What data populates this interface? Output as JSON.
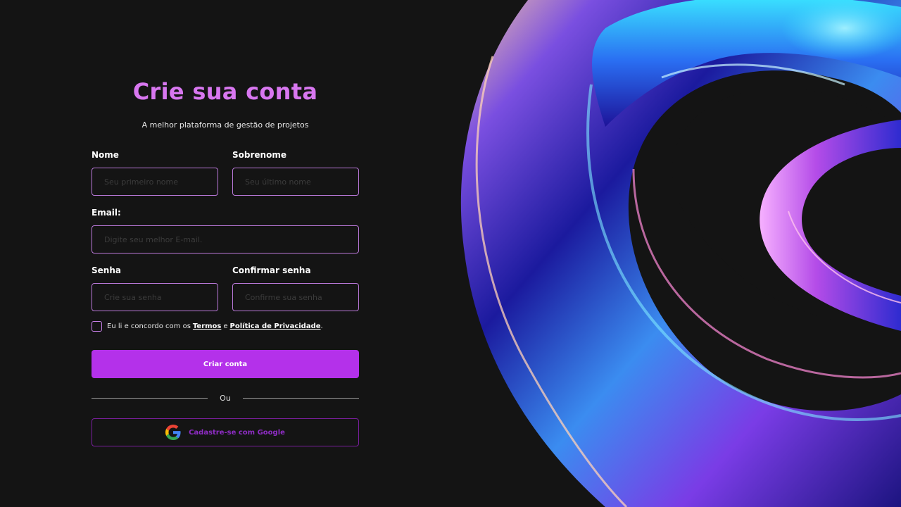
{
  "form": {
    "title": "Crie sua conta",
    "subtitle": "A melhor plataforma de gestão de projetos",
    "first_name": {
      "label": "Nome",
      "placeholder": "Seu primeiro nome",
      "value": ""
    },
    "last_name": {
      "label": "Sobrenome",
      "placeholder": "Seu último nome",
      "value": ""
    },
    "email": {
      "label": "Email:",
      "placeholder": "Digite seu melhor E-mail.",
      "value": ""
    },
    "password": {
      "label": "Senha",
      "placeholder": "Crie sua senha",
      "value": ""
    },
    "confirm_password": {
      "label": "Confirmar senha",
      "placeholder": "Confirme sua senha",
      "value": ""
    },
    "terms": {
      "checked": false,
      "prefix": "Eu li e concordo com os",
      "terms_link": "Termos",
      "conjunction": "e",
      "privacy_link": "Política de Privacidade",
      "suffix": "."
    },
    "submit_label": "Criar conta",
    "divider_label": "Ou",
    "google_label": "Cadastre-se com Google"
  },
  "icons": {
    "checkbox": "checkbox-unchecked",
    "google": "google-logo-icon"
  },
  "colors": {
    "background": "#141414",
    "title": "#d877f0",
    "input_border": "#b978d8",
    "primary_button": "#b431ea",
    "google_border": "#7a1f9e",
    "google_text": "#8e2cc4"
  }
}
